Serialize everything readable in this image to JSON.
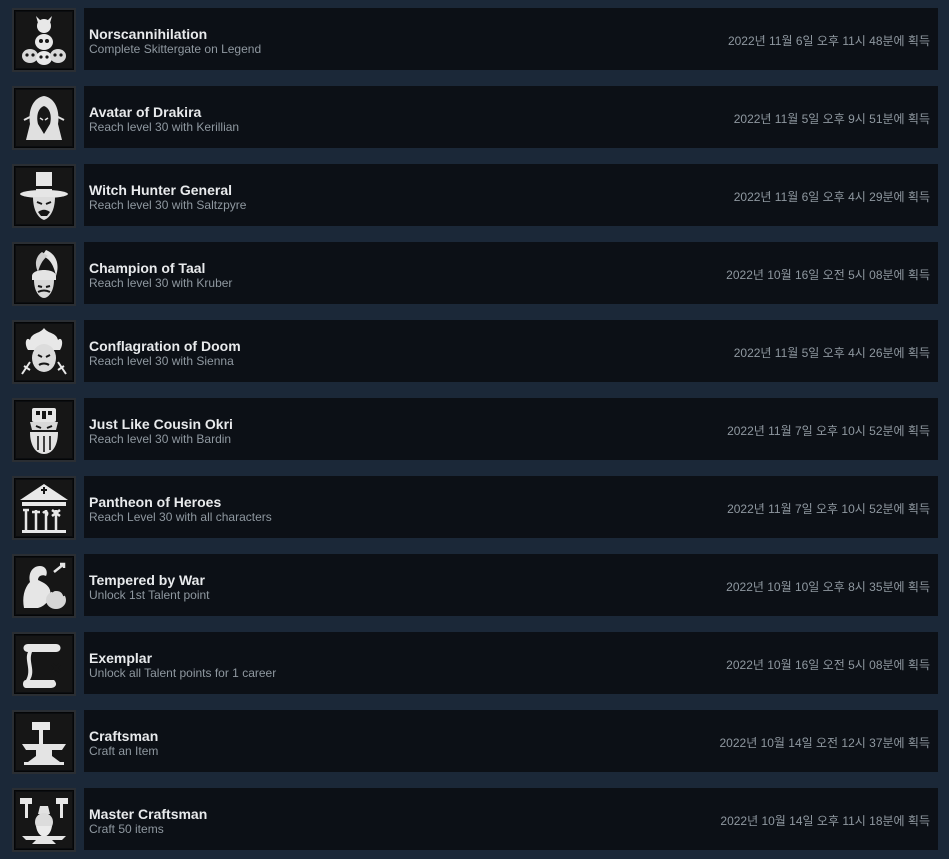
{
  "achievements": [
    {
      "title": "Norscannihilation",
      "description": "Complete Skittergate on Legend",
      "unlock_time": "2022년 11월 6일 오후 11시 48분에 획득",
      "icon": "skull-pile-icon"
    },
    {
      "title": "Avatar of Drakira",
      "description": "Reach level 30 with Kerillian",
      "unlock_time": "2022년 11월 5일 오후 9시 51분에 획득",
      "icon": "hooded-elf-icon"
    },
    {
      "title": "Witch Hunter General",
      "description": "Reach level 30 with Saltzpyre",
      "unlock_time": "2022년 11월 6일 오후 4시 29분에 획득",
      "icon": "witch-hunter-hat-icon"
    },
    {
      "title": "Champion of Taal",
      "description": "Reach level 30 with Kruber",
      "unlock_time": "2022년 10월 16일 오전 5시 08분에 획득",
      "icon": "plumed-helmet-icon"
    },
    {
      "title": "Conflagration of Doom",
      "description": "Reach level 30 with Sienna",
      "unlock_time": "2022년 11월 5일 오후 4시 26분에 획득",
      "icon": "flaming-head-icon"
    },
    {
      "title": "Just Like Cousin Okri",
      "description": "Reach level 30 with Bardin",
      "unlock_time": "2022년 11월 7일 오후 10시 52분에 획득",
      "icon": "dwarf-helmet-icon"
    },
    {
      "title": "Pantheon of Heroes",
      "description": "Reach Level 30 with all characters",
      "unlock_time": "2022년 11월 7일 오후 10시 52분에 획득",
      "icon": "temple-weapons-icon"
    },
    {
      "title": "Tempered by War",
      "description": "Unlock 1st Talent point",
      "unlock_time": "2022년 10월 10일 오후 8시 35분에 획득",
      "icon": "flexed-arm-icon"
    },
    {
      "title": "Exemplar",
      "description": "Unlock all Talent points for 1 career",
      "unlock_time": "2022년 10월 16일 오전 5시 08분에 획득",
      "icon": "scroll-icon"
    },
    {
      "title": "Craftsman",
      "description": "Craft an Item",
      "unlock_time": "2022년 10월 14일 오전 12시 37분에 획득",
      "icon": "hammer-anvil-icon"
    },
    {
      "title": "Master Craftsman",
      "description": "Craft 50 items",
      "unlock_time": "2022년 10월 14일 오후 11시 18분에 획득",
      "icon": "dwarf-smith-icon"
    }
  ]
}
